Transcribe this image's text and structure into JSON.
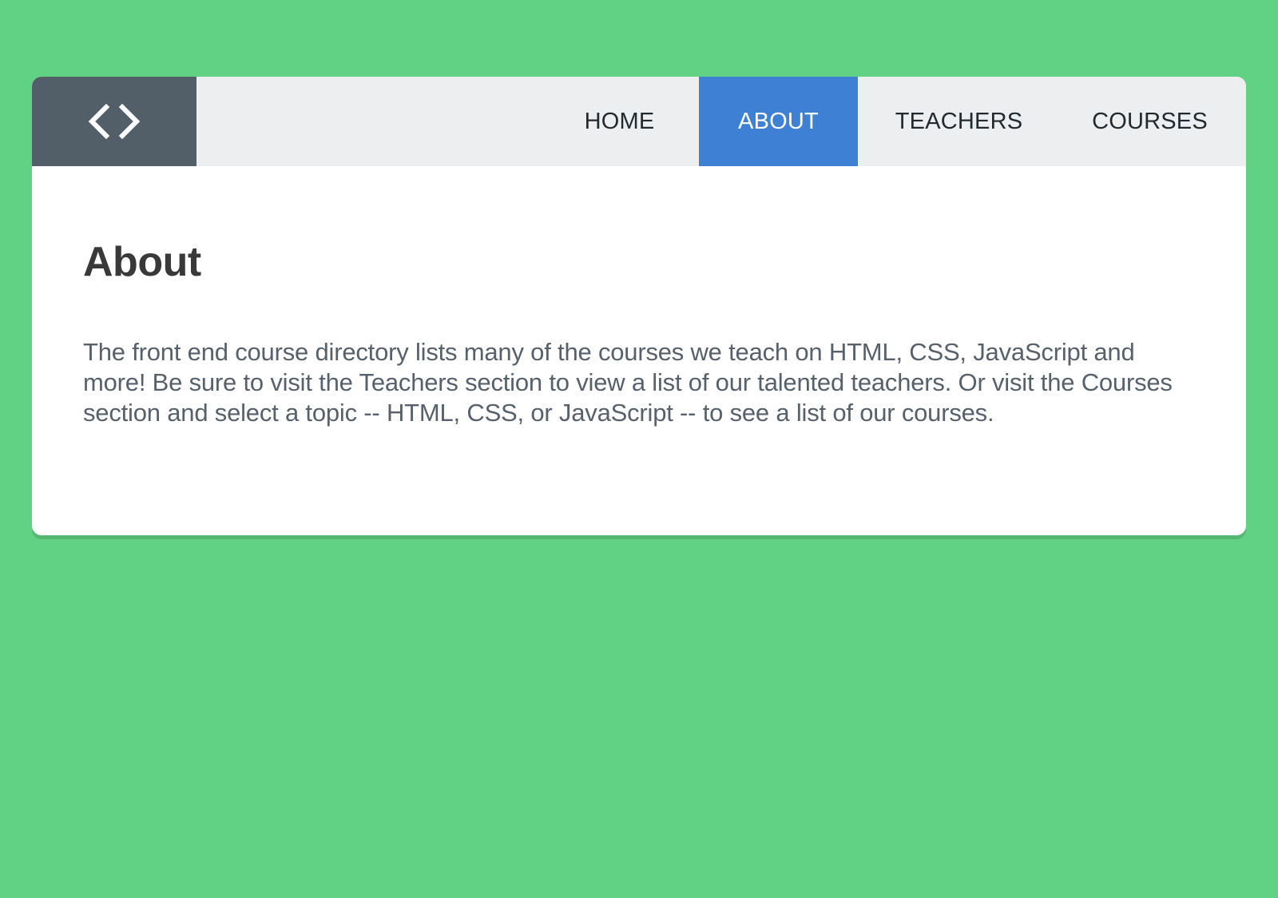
{
  "header": {
    "logo_icon": "code-brackets-icon",
    "nav": [
      {
        "label": "HOME",
        "active": false
      },
      {
        "label": "ABOUT",
        "active": true
      },
      {
        "label": "TEACHERS",
        "active": false
      },
      {
        "label": "COURSES",
        "active": false
      }
    ]
  },
  "main": {
    "title": "About",
    "text": "The front end course directory lists many of the courses we teach on HTML, CSS, JavaScript and more! Be sure to visit the Teachers section to view a list of our talented teachers. Or visit the Courses section and select a topic -- HTML, CSS, or JavaScript -- to see a list of our courses."
  },
  "colors": {
    "background": "#61d183",
    "header": "#edeeef",
    "logo": "#525e68",
    "active_nav": "#3e81d4",
    "title": "#393939",
    "body_text": "#56616b"
  }
}
